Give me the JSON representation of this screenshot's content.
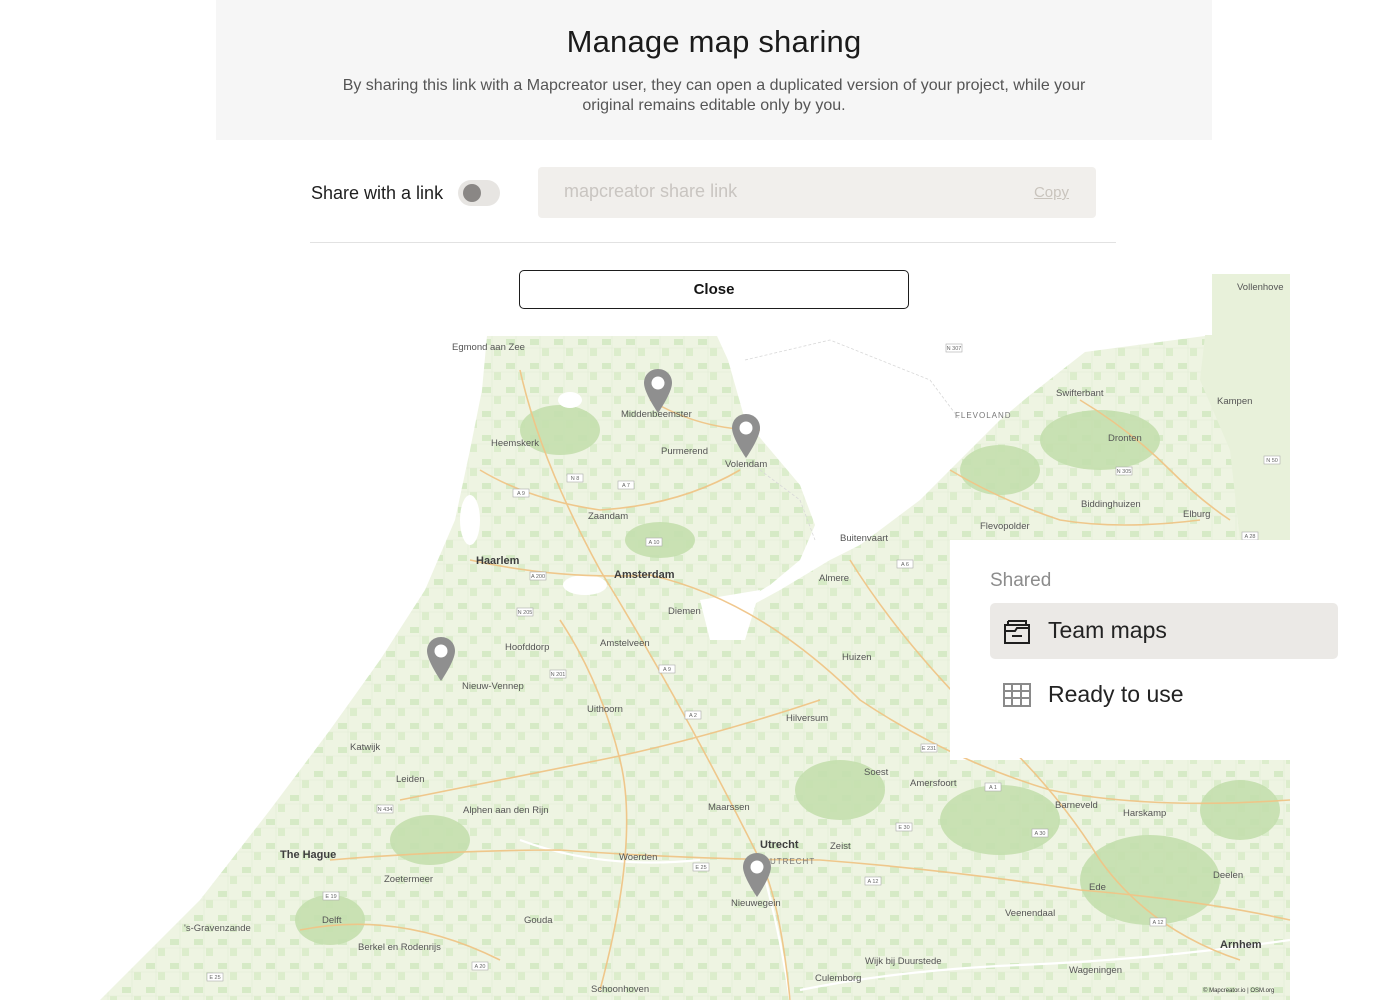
{
  "modal": {
    "title": "Manage map sharing",
    "description": "By sharing this link with a Mapcreator user, they can open a duplicated version of your project, while your original remains editable only by you.",
    "share_toggle": {
      "label": "Share with a link",
      "enabled": false
    },
    "share_link": {
      "value": "",
      "placeholder": "mapcreator share link"
    },
    "copy_label": "Copy",
    "close_label": "Close"
  },
  "side_panel": {
    "heading": "Shared",
    "items": [
      {
        "label": "Team maps",
        "icon": "folder-icon",
        "active": true
      },
      {
        "label": "Ready to use",
        "icon": "map-grid-icon",
        "active": false
      }
    ]
  },
  "map": {
    "places": {
      "egmond": "Egmond aan Zee",
      "middenbeemster": "Middenbeemster",
      "volendam": "Volendam",
      "purmerend": "Purmerend",
      "heemskerk": "Heemskerk",
      "zaandam": "Zaandam",
      "haarlem": "Haarlem",
      "amsterdam": "Amsterdam",
      "diemen": "Diemen",
      "hoofddorp": "Hoofddorp",
      "amstelveen": "Amstelveen",
      "nieuw_vennep": "Nieuw-Vennep",
      "uithoorn": "Uithoorn",
      "katwijk": "Katwijk",
      "leiden": "Leiden",
      "alphen": "Alphen aan den Rijn",
      "the_hague": "The Hague",
      "zoetermeer": "Zoetermeer",
      "delft": "Delft",
      "gravenzande": "'s-Gravenzande",
      "berkel": "Berkel en Rodenrijs",
      "gouda": "Gouda",
      "woerden": "Woerden",
      "utrecht": "Utrecht",
      "utrecht_region": "UTRECHT",
      "nieuwegein": "Nieuwegein",
      "zeist": "Zeist",
      "maarssen": "Maarssen",
      "hilversum": "Hilversum",
      "huizen": "Huizen",
      "almere": "Almere",
      "buitenvaart": "Buitenvaart",
      "flevopolder": "Flevopolder",
      "flevoland": "FLEVOLAND",
      "swifterbant": "Swifterbant",
      "dronten": "Dronten",
      "biddinghuizen": "Biddinghuizen",
      "elburg": "Elburg",
      "kampen": "Kampen",
      "vollenhove": "Vollenhove",
      "soest": "Soest",
      "amersfoort": "Amersfoort",
      "barneveld": "Barneveld",
      "harskamp": "Harskamp",
      "ede": "Ede",
      "deelen": "Deelen",
      "veenendaal": "Veenendaal",
      "arnhem": "Arnhem",
      "wageningen": "Wageningen",
      "wijk_bij_duurstede": "Wijk bij Duurstede",
      "culemborg": "Culemborg",
      "schoonhoven": "Schoonhoven"
    },
    "roads": [
      "N 307",
      "N 8",
      "A 9",
      "A 7",
      "A 10",
      "A 200",
      "N 205",
      "N 201",
      "A 9",
      "A 2",
      "A 6",
      "N 305",
      "N 50",
      "A 28",
      "E 231",
      "A 1",
      "E 30",
      "A 30",
      "A 12",
      "E 25",
      "E 19",
      "N 434",
      "A 20",
      "E 25",
      "A 12"
    ],
    "credit": "© Mapcreator.io | OSM.org",
    "colors": {
      "land": "#eef3e3",
      "forest": "#c8e2b4",
      "water": "#ffffff",
      "road": "#f2c88a",
      "marker": "#8f8f8f"
    }
  }
}
